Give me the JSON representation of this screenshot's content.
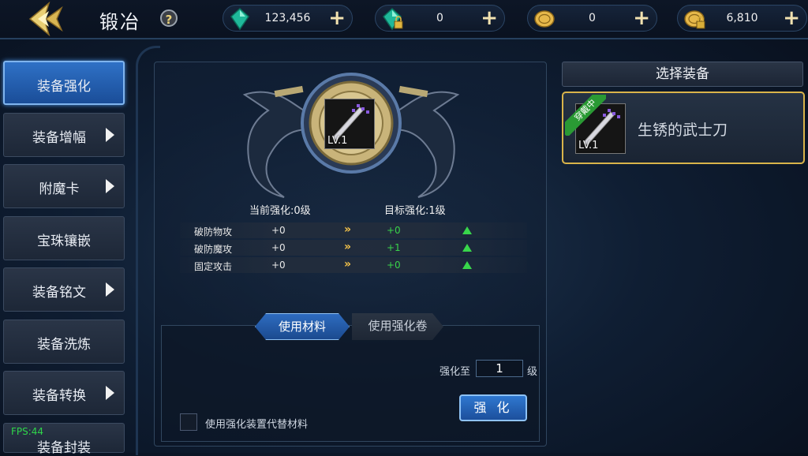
{
  "header": {
    "title": "锻冶",
    "help_label": "?",
    "currencies": [
      {
        "name": "green-gem",
        "value": "123,456",
        "plus": "+"
      },
      {
        "name": "locked-green-gem",
        "value": "0",
        "plus": "+"
      },
      {
        "name": "gold-coin",
        "value": "0",
        "plus": "+"
      },
      {
        "name": "locked-gold-coin",
        "value": "6,810",
        "plus": "+"
      }
    ]
  },
  "menu": {
    "items": [
      {
        "label": "装备强化",
        "active": true
      },
      {
        "label": "装备增幅",
        "arrow": true
      },
      {
        "label": "附魔卡",
        "arrow": true
      },
      {
        "label": "宝珠镶嵌"
      },
      {
        "label": "装备铭文",
        "arrow": true
      },
      {
        "label": "装备洗炼"
      },
      {
        "label": "装备转换",
        "arrow": true
      },
      {
        "label": "装备封装"
      }
    ]
  },
  "fps": "FPS:44",
  "center": {
    "item_level": "LV.1",
    "current_level": "当前强化:0级",
    "target_level": "目标强化:1级",
    "stats": [
      {
        "name": "破防物攻",
        "current": "+0",
        "arrow": "»",
        "new": "+0"
      },
      {
        "name": "破防魔攻",
        "current": "+0",
        "arrow": "»",
        "new": "+1"
      },
      {
        "name": "固定攻击",
        "current": "+0",
        "arrow": "»",
        "new": "+0"
      }
    ],
    "tabs": [
      "使用材料",
      "使用强化卷"
    ],
    "enhance_to_label": "强化至",
    "enhance_to_value": "1",
    "level_unit": "级",
    "enhance_button": "强 化",
    "substitute_label": "使用强化装置代替材料"
  },
  "right": {
    "header": "选择装备",
    "equipped_badge": "穿戴中",
    "item_level": "LV.1",
    "item_name": "生锈的武士刀"
  },
  "colors": {
    "accent_blue": "#2f71c6",
    "selected_gold": "#d9b44a",
    "stat_up_green": "#38d64b",
    "arrow_gold": "#f3c24a"
  }
}
